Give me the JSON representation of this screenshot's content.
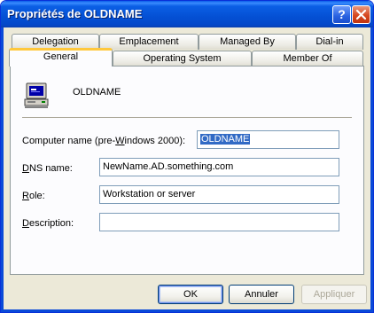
{
  "window": {
    "title": "Propriétés de OLDNAME",
    "help_button": "?",
    "close_button": "×"
  },
  "tabs": {
    "row1": [
      "Delegation",
      "Emplacement",
      "Managed By",
      "Dial-in"
    ],
    "row2": [
      "General",
      "Operating System",
      "Member Of"
    ],
    "selected": "General"
  },
  "general": {
    "object_name": "OLDNAME",
    "computer_name_label_pre": "Computer name (pre-",
    "computer_name_label_key": "W",
    "computer_name_label_post": "indows 2000):",
    "computer_name_value": "OLDNAME",
    "dns_label_key": "D",
    "dns_label_post": "NS name:",
    "dns_value": "NewName.AD.something.com",
    "role_label_key": "R",
    "role_label_post": "ole:",
    "role_value": "Workstation or server",
    "description_label_key": "D",
    "description_label_post": "escription:",
    "description_value": ""
  },
  "buttons": {
    "ok": "OK",
    "cancel": "Annuler",
    "apply": "Appliquer"
  },
  "colors": {
    "titlebar": "#0450d4",
    "selection": "#316ac5",
    "tab_highlight": "#ffc83c",
    "close_button": "#d6471f"
  }
}
